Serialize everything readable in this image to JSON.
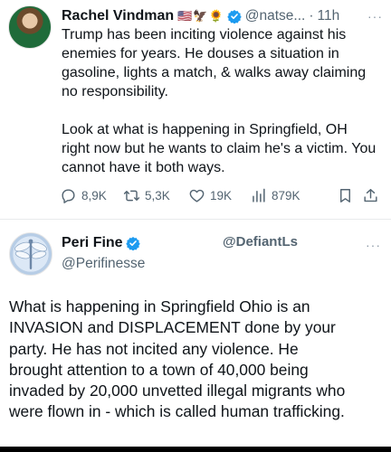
{
  "tweet1": {
    "name": "Rachel Vindman",
    "flags": "🇺🇸🦅🌻",
    "handle": "@natse...",
    "time": "11h",
    "body_p1": "Trump has been inciting violence against his enemies for years. He douses a situation in gasoline, lights a match, & walks away claiming no responsibility.",
    "body_p2": "Look at what is happening in Springfield, OH right now but he wants to claim he's a victim. You cannot have it both ways.",
    "stats": {
      "replies": "8,9K",
      "reposts": "5,3K",
      "likes": "19K",
      "views": "879K"
    }
  },
  "tweet2": {
    "name": "Peri Fine",
    "handle": "@Perifinesse",
    "mention": "@DefiantLs",
    "body_lines": [
      "What is happening in Springfield Ohio is an",
      "INVASION and DISPLACEMENT done by your",
      "party. He has not incited any violence. He",
      "brought attention to a town of 40,000 being",
      "invaded by 20,000 unvetted illegal migrants who",
      "were flown in - which is called human trafficking."
    ]
  },
  "colors": {
    "verified": "#1d9bf0",
    "secondary_text": "#536471"
  }
}
